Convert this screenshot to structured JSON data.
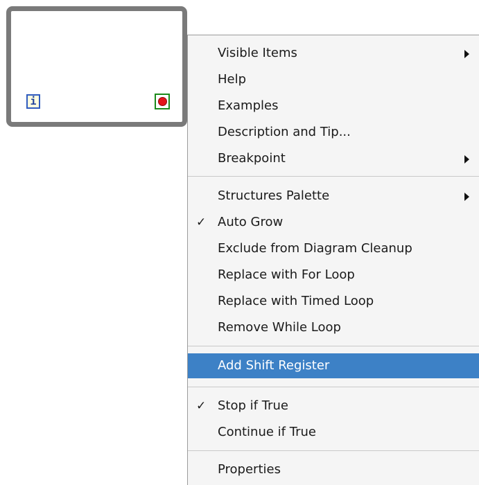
{
  "block_diagram": {
    "iteration_terminal_label": "i"
  },
  "context_menu": {
    "group1": [
      {
        "label": "Visible Items",
        "submenu": true
      },
      {
        "label": "Help"
      },
      {
        "label": "Examples"
      },
      {
        "label": "Description and Tip..."
      },
      {
        "label": "Breakpoint",
        "submenu": true
      }
    ],
    "group2": [
      {
        "label": "Structures Palette",
        "submenu": true
      },
      {
        "label": "Auto Grow",
        "checked": true
      },
      {
        "label": "Exclude from Diagram Cleanup"
      },
      {
        "label": "Replace with For Loop"
      },
      {
        "label": "Replace with Timed Loop"
      },
      {
        "label": "Remove While Loop"
      }
    ],
    "group3": [
      {
        "label": "Add Shift Register",
        "highlighted": true
      }
    ],
    "group4": [
      {
        "label": "Stop if True",
        "checked": true
      },
      {
        "label": "Continue if True"
      }
    ],
    "group5": [
      {
        "label": "Properties"
      }
    ],
    "check_glyph": "✓",
    "highlight_color": "#3d81c6",
    "menu_background": "#f5f5f5"
  }
}
